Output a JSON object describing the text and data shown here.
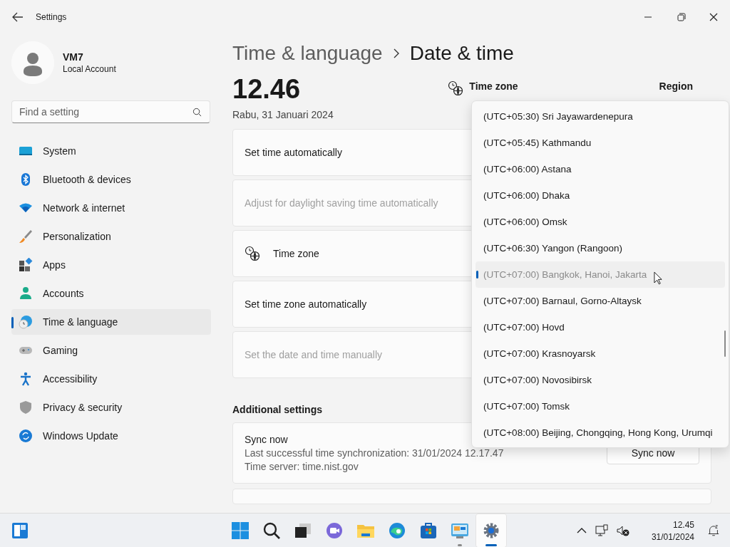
{
  "window": {
    "title": "Settings"
  },
  "profile": {
    "name": "VM7",
    "account": "Local Account"
  },
  "search": {
    "placeholder": "Find a setting"
  },
  "sidebar": {
    "items": [
      {
        "label": "System",
        "kind": "system",
        "selected": false
      },
      {
        "label": "Bluetooth & devices",
        "kind": "bluetooth",
        "selected": false
      },
      {
        "label": "Network & internet",
        "kind": "network",
        "selected": false
      },
      {
        "label": "Personalization",
        "kind": "brush",
        "selected": false
      },
      {
        "label": "Apps",
        "kind": "apps",
        "selected": false
      },
      {
        "label": "Accounts",
        "kind": "accounts",
        "selected": false
      },
      {
        "label": "Time & language",
        "kind": "time",
        "selected": true
      },
      {
        "label": "Gaming",
        "kind": "gaming",
        "selected": false
      },
      {
        "label": "Accessibility",
        "kind": "accessibility",
        "selected": false
      },
      {
        "label": "Privacy & security",
        "kind": "privacy",
        "selected": false
      },
      {
        "label": "Windows Update",
        "kind": "update",
        "selected": false
      }
    ]
  },
  "breadcrumb": {
    "parent": "Time & language",
    "current": "Date & time"
  },
  "clock": {
    "time": "12.46",
    "date": "Rabu, 31 Januari 2024"
  },
  "header_info": [
    {
      "label": "Time zone",
      "kind": "timezone"
    },
    {
      "label": "Region",
      "kind": "region"
    }
  ],
  "settings": [
    {
      "label": "Set time automatically",
      "kind": "plain",
      "disabled": false
    },
    {
      "label": "Adjust for daylight saving time automatically",
      "kind": "plain",
      "disabled": true
    },
    {
      "label": "Time zone",
      "kind": "timezone",
      "disabled": false
    },
    {
      "label": "Set time zone automatically",
      "kind": "plain",
      "disabled": false
    },
    {
      "label": "Set the date and time manually",
      "kind": "plain",
      "disabled": true
    }
  ],
  "additional": {
    "title": "Additional settings",
    "sync": {
      "title": "Sync now",
      "last": "Last successful time synchronization: 31/01/2024 12.17.47",
      "server": "Time server: time.nist.gov",
      "button": "Sync now"
    }
  },
  "timezone_dropdown": {
    "options": [
      {
        "label": "(UTC+05:30) Sri Jayawardenepura",
        "selected": false
      },
      {
        "label": "(UTC+05:45) Kathmandu",
        "selected": false
      },
      {
        "label": "(UTC+06:00) Astana",
        "selected": false
      },
      {
        "label": "(UTC+06:00) Dhaka",
        "selected": false
      },
      {
        "label": "(UTC+06:00) Omsk",
        "selected": false
      },
      {
        "label": "(UTC+06:30) Yangon (Rangoon)",
        "selected": false
      },
      {
        "label": "(UTC+07:00) Bangkok, Hanoi, Jakarta",
        "selected": true
      },
      {
        "label": "(UTC+07:00) Barnaul, Gorno-Altaysk",
        "selected": false
      },
      {
        "label": "(UTC+07:00) Hovd",
        "selected": false
      },
      {
        "label": "(UTC+07:00) Krasnoyarsk",
        "selected": false
      },
      {
        "label": "(UTC+07:00) Novosibirsk",
        "selected": false
      },
      {
        "label": "(UTC+07:00) Tomsk",
        "selected": false
      },
      {
        "label": "(UTC+08:00) Beijing, Chongqing, Hong Kong, Urumqi",
        "selected": false
      }
    ]
  },
  "taskbar": {
    "apps": [
      {
        "kind": "start",
        "running": false,
        "selected": false
      },
      {
        "kind": "search",
        "running": false,
        "selected": false
      },
      {
        "kind": "taskview",
        "running": false,
        "selected": false
      },
      {
        "kind": "chat",
        "running": false,
        "selected": false
      },
      {
        "kind": "explorer",
        "running": false,
        "selected": false
      },
      {
        "kind": "edge",
        "running": false,
        "selected": false
      },
      {
        "kind": "store",
        "running": false,
        "selected": false
      },
      {
        "kind": "control",
        "running": true,
        "selected": false
      },
      {
        "kind": "settings",
        "running": true,
        "selected": true
      }
    ],
    "time": "12.45",
    "date": "31/01/2024"
  }
}
